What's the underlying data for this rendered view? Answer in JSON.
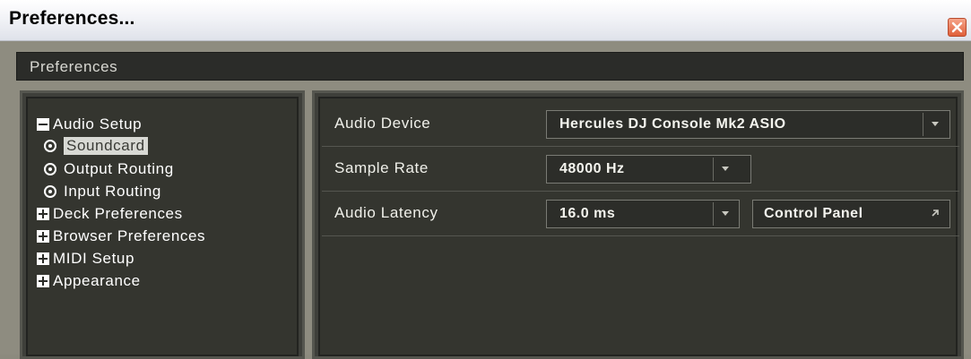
{
  "window": {
    "title": "Preferences..."
  },
  "header": {
    "title": "Preferences"
  },
  "tree": {
    "items": [
      {
        "label": "Audio Setup",
        "icon": "minus-box-icon"
      },
      {
        "label": "Soundcard",
        "icon": "radio-icon",
        "selected": true
      },
      {
        "label": "Output Routing",
        "icon": "radio-icon"
      },
      {
        "label": "Input Routing",
        "icon": "radio-icon"
      },
      {
        "label": "Deck Preferences",
        "icon": "plus-box-icon"
      },
      {
        "label": "Browser Preferences",
        "icon": "plus-box-icon"
      },
      {
        "label": "MIDI Setup",
        "icon": "plus-box-icon"
      },
      {
        "label": "Appearance",
        "icon": "plus-box-icon"
      }
    ]
  },
  "settings": {
    "audio_device": {
      "label": "Audio Device",
      "value": "Hercules DJ Console Mk2 ASIO"
    },
    "sample_rate": {
      "label": "Sample Rate",
      "value": "48000 Hz"
    },
    "audio_latency": {
      "label": "Audio Latency",
      "value": "16.0 ms"
    },
    "control_panel_label": "Control Panel"
  },
  "colors": {
    "background": "#8c8a7e",
    "panel": "#34352f",
    "header": "#2b2c29",
    "close": "#e0603a"
  }
}
